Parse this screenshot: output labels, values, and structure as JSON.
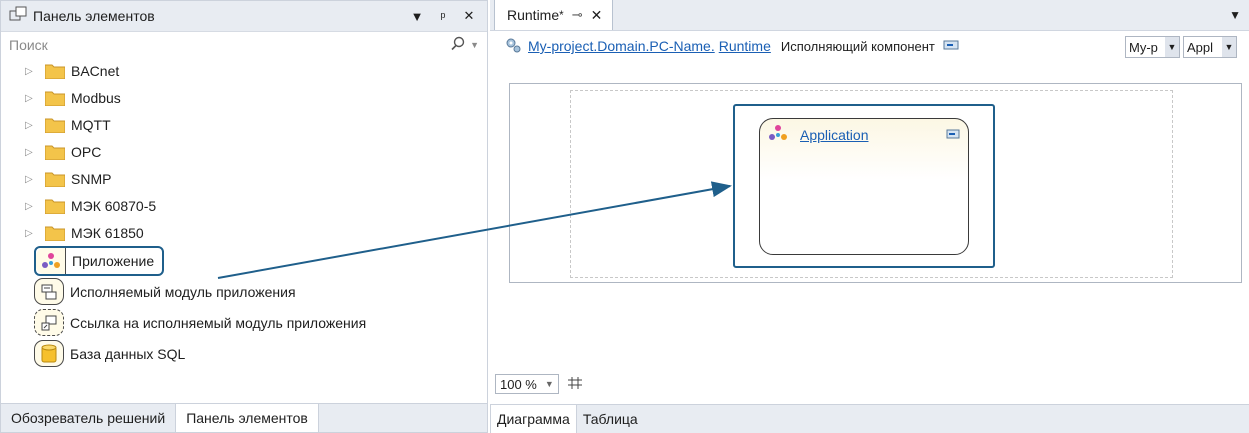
{
  "toolbox": {
    "title": "Панель элементов",
    "search_placeholder": "Поиск",
    "folders": [
      {
        "label": "BACnet"
      },
      {
        "label": "Modbus"
      },
      {
        "label": "MQTT"
      },
      {
        "label": "OPC"
      },
      {
        "label": "SNMP"
      },
      {
        "label": "МЭК 60870-5"
      },
      {
        "label": "МЭК 61850"
      }
    ],
    "items": [
      {
        "label": "Приложение",
        "icon": "application-icon"
      },
      {
        "label": "Исполняемый модуль приложения",
        "icon": "executable-module-icon"
      },
      {
        "label": "Ссылка на исполняемый модуль приложения",
        "icon": "module-link-icon"
      },
      {
        "label": "База данных SQL",
        "icon": "database-icon"
      }
    ],
    "tabs": [
      {
        "label": "Обозреватель решений"
      },
      {
        "label": "Панель элементов"
      }
    ]
  },
  "document": {
    "tab_title": "Runtime",
    "tab_modified_mark": "*",
    "breadcrumb_link1": "My-project.Domain.PC-Name.",
    "breadcrumb_link2": "Runtime",
    "executing_component_label": "Исполняющий компонент",
    "select1_value": "My-p",
    "select2_value": "Appl",
    "application_box_label": "Application",
    "zoom_value": "100 %",
    "bottom_tabs": [
      {
        "label": "Диаграмма"
      },
      {
        "label": "Таблица"
      }
    ]
  },
  "colors": {
    "highlight": "#1f5f8b",
    "link": "#1a5fb4",
    "panel_bg": "#e8ecf2",
    "folder": "#f3c44a"
  }
}
